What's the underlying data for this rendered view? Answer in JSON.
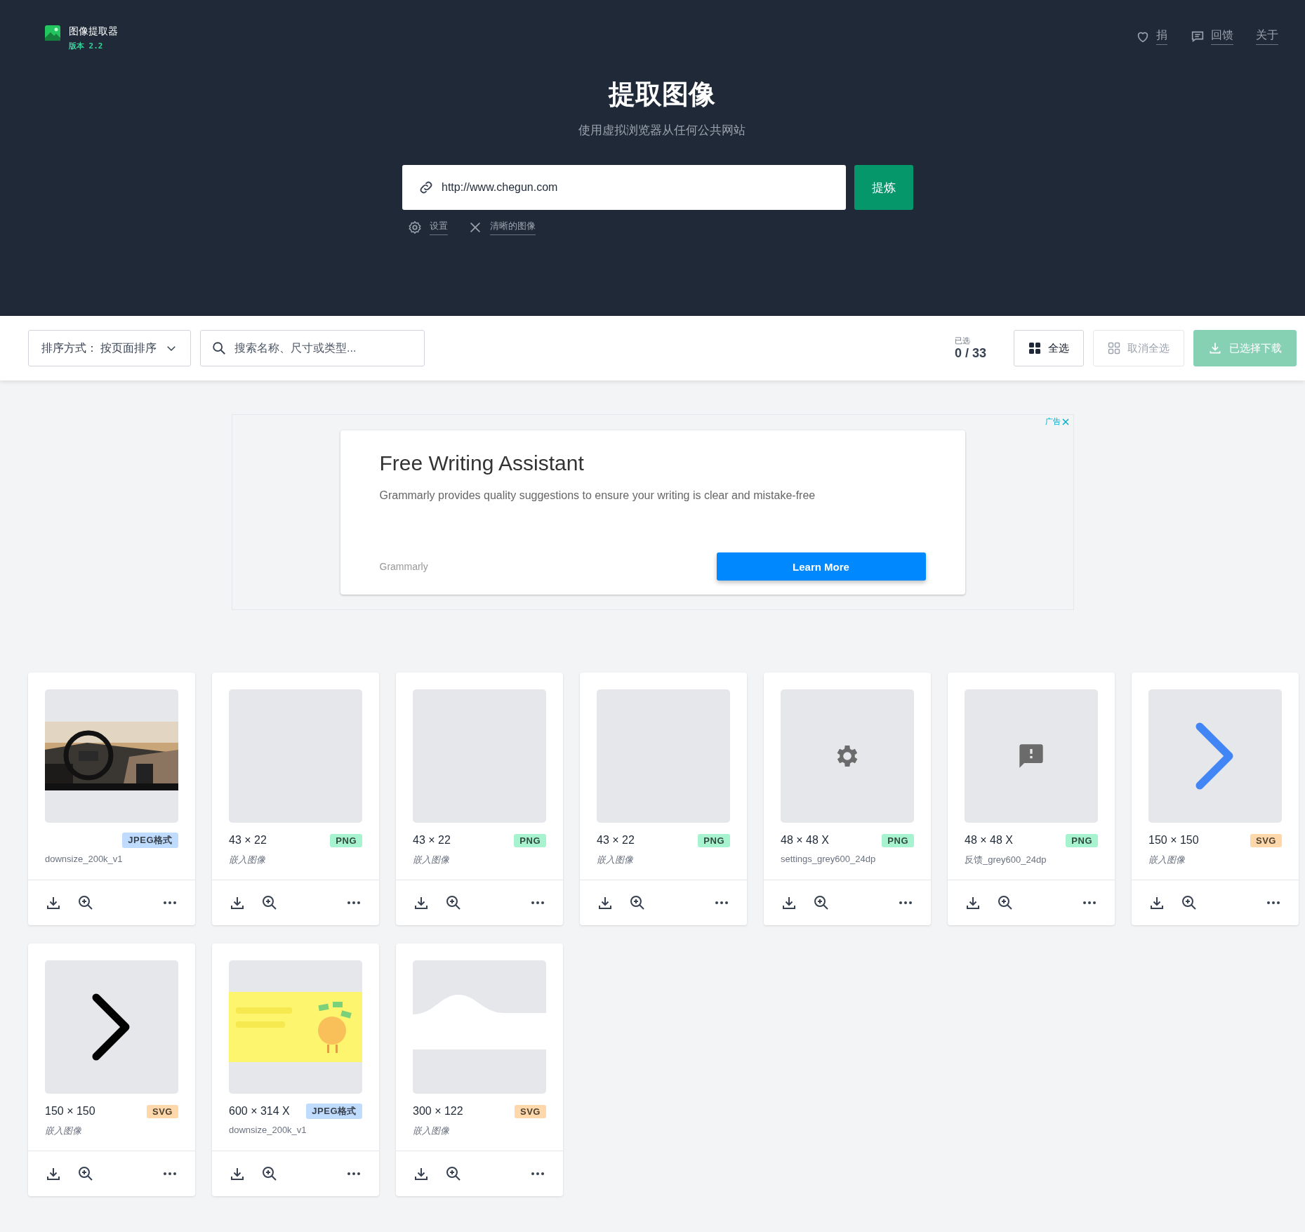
{
  "app": {
    "name": "图像提取器",
    "version": "版本 2.2"
  },
  "nav": [
    {
      "kind": "heart",
      "label": "捐"
    },
    {
      "kind": "comment",
      "label": "回馈"
    },
    {
      "kind": "plain",
      "label": "关于"
    }
  ],
  "hero": {
    "title": "提取图像",
    "subtitle": "使用虚拟浏览器从任何公共网站"
  },
  "url_field": {
    "value": "http://www.chegun.com"
  },
  "extract_button": "提炼",
  "options": [
    {
      "kind": "settings",
      "label": "设置"
    },
    {
      "kind": "clear",
      "label": "清晰的图像"
    }
  ],
  "toolbar": {
    "sort_label": "排序方式：",
    "sort_value": "按页面排序",
    "search": {
      "placeholder": "搜索名称、尺寸或类型..."
    },
    "selected_label": "已选",
    "selected_count": "0 / 33",
    "buttons": [
      {
        "kind": "select_all",
        "label": "全选",
        "disabled": false
      },
      {
        "kind": "deselect_all",
        "label": "取消全选",
        "disabled": true
      },
      {
        "kind": "download",
        "label": "已选择下载",
        "disabled": true
      }
    ]
  },
  "ad": {
    "badge": "广告",
    "title": "Free Writing Assistant",
    "description": "Grammarly provides quality suggestions to ensure your writing is clear and mistake-free",
    "advertiser": "Grammarly",
    "button": "Learn More"
  },
  "images": [
    {
      "format": {
        "label": "JPEG格式",
        "color": "#bfdbfe"
      },
      "name": "downsize_200k_v1",
      "embedded": false
    },
    {
      "kind": "blank",
      "dimensions": "43 × 22",
      "format": {
        "label": "PNG",
        "color": "#a7f3d0"
      },
      "name": "嵌入图像",
      "embedded": true
    },
    {
      "kind": "blank",
      "dimensions": "43 × 22",
      "format": {
        "label": "PNG",
        "color": "#a7f3d0"
      },
      "name": "嵌入图像",
      "embedded": true
    },
    {
      "kind": "blank",
      "dimensions": "43 × 22",
      "format": {
        "label": "PNG",
        "color": "#a7f3d0"
      },
      "name": "嵌入图像",
      "embedded": true
    },
    {
      "kind": "gear",
      "dimensions": "48 × 48 X",
      "format": {
        "label": "PNG",
        "color": "#a7f3d0"
      },
      "name": "settings_grey600_24dp",
      "embedded": false
    },
    {
      "kind": "feedback",
      "dimensions": "48 × 48 X",
      "format": {
        "label": "PNG",
        "color": "#a7f3d0"
      },
      "name": "反馈_grey600_24dp",
      "embedded": false
    },
    {
      "kind": "chevron",
      "color": "#4285f4",
      "dimensions": "150 × 150",
      "format": {
        "label": "SVG",
        "color": "#fed7aa"
      },
      "name": "嵌入图像",
      "embedded": true
    },
    {
      "kind": "chevron",
      "color": "#000000",
      "dimensions": "150 × 150",
      "format": {
        "label": "SVG",
        "color": "#fed7aa"
      },
      "name": "嵌入图像",
      "embedded": true
    },
    {
      "kind": "banner",
      "dimensions": "600 × 314 X",
      "format": {
        "label": "JPEG格式",
        "color": "#bfdbfe"
      },
      "name": "downsize_200k_v1",
      "embedded": false
    },
    {
      "kind": "wave",
      "dimensions": "300 × 122",
      "format": {
        "label": "SVG",
        "color": "#fed7aa"
      },
      "name": "嵌入图像",
      "embedded": true
    }
  ]
}
